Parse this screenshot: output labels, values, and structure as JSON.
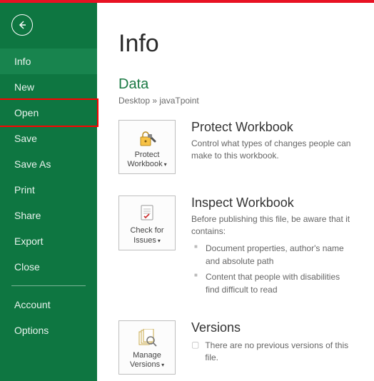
{
  "sidebar": {
    "items": [
      {
        "label": "Info",
        "active": true
      },
      {
        "label": "New"
      },
      {
        "label": "Open",
        "highlighted": true
      },
      {
        "label": "Save"
      },
      {
        "label": "Save As"
      },
      {
        "label": "Print"
      },
      {
        "label": "Share"
      },
      {
        "label": "Export"
      },
      {
        "label": "Close"
      }
    ],
    "footer": [
      {
        "label": "Account"
      },
      {
        "label": "Options"
      }
    ]
  },
  "content": {
    "title": "Info",
    "doc_name": "Data",
    "doc_path": "Desktop » javaTpoint",
    "sections": {
      "protect": {
        "tile_label": "Protect Workbook",
        "title": "Protect Workbook",
        "text": "Control what types of changes people can make to this workbook."
      },
      "inspect": {
        "tile_label": "Check for Issues",
        "title": "Inspect Workbook",
        "text": "Before publishing this file, be aware that it contains:",
        "bullets": [
          "Document properties, author's name and absolute path",
          "Content that people with disabilities find difficult to read"
        ]
      },
      "versions": {
        "tile_label": "Manage Versions",
        "title": "Versions",
        "text": "There are no previous versions of this file."
      }
    }
  }
}
